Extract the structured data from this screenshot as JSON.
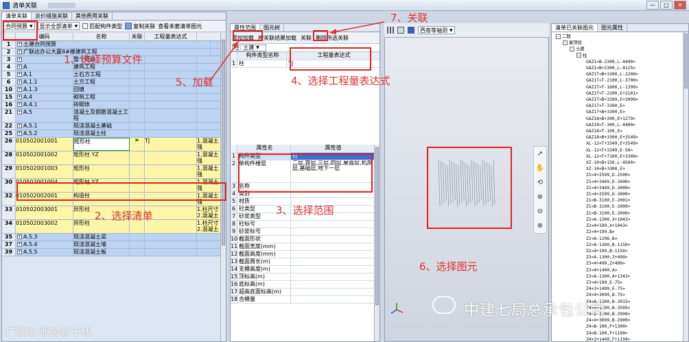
{
  "window": {
    "title": "清单关联",
    "min": "—",
    "max": "□",
    "close": "✕"
  },
  "left": {
    "tabs": [
      "清单关联",
      "总价措施关联",
      "其他费用关联"
    ],
    "toolbar": {
      "budget_select": "合同预算",
      "display_select": "显示全部清单",
      "checkbox_label": "匹配构件类型",
      "copy_label": "复制关联",
      "view_label": "查看未套清单图元"
    },
    "columns": [
      "",
      "编码",
      "名称",
      "关联",
      "工程量表达式"
    ],
    "rows": [
      {
        "n": "1",
        "code": "土建合同预算",
        "name": "",
        "rel": "",
        "exp": "",
        "x": "",
        "style": "blue",
        "tree": "pm",
        "span": true
      },
      {
        "n": "2",
        "code": "广联达办公大厦8#楼建筑工程",
        "name": "",
        "rel": "",
        "exp": "",
        "x": "",
        "style": "blue",
        "tree": "pm",
        "span": true
      },
      {
        "n": "3",
        "code": "",
        "name": "整个项目",
        "rel": "",
        "exp": "",
        "x": "",
        "style": "blue",
        "tree": "pm"
      },
      {
        "n": "4",
        "code": "A",
        "name": "建筑工程",
        "rel": "",
        "exp": "",
        "x": "",
        "style": "blue",
        "tree": "pm"
      },
      {
        "n": "5",
        "code": "A.1",
        "name": "土石方工程",
        "rel": "",
        "exp": "",
        "x": "",
        "style": "blue",
        "tree": "pm"
      },
      {
        "n": "6",
        "code": "A.1.1",
        "name": "土方工程",
        "rel": "",
        "exp": "",
        "x": "",
        "style": "blue",
        "tree": "pm"
      },
      {
        "n": "10",
        "code": "A.1.3",
        "name": "回填",
        "rel": "",
        "exp": "",
        "x": "",
        "style": "blue",
        "tree": "pm"
      },
      {
        "n": "15",
        "code": "A.4",
        "name": "砌筑工程",
        "rel": "",
        "exp": "",
        "x": "",
        "style": "blue",
        "tree": "pm"
      },
      {
        "n": "16",
        "code": "A.4.1",
        "name": "砖砌体",
        "rel": "",
        "exp": "",
        "x": "",
        "style": "blue",
        "tree": "pm"
      },
      {
        "n": "21",
        "code": "A.5",
        "name": "混凝土及钢筋混凝土工程",
        "rel": "",
        "exp": "",
        "x": "",
        "style": "blue",
        "tree": "pm",
        "tall": true
      },
      {
        "n": "22",
        "code": "A.5.1",
        "name": "现浇混凝土基础",
        "rel": "",
        "exp": "",
        "x": "",
        "style": "blue",
        "tree": "pm"
      },
      {
        "n": "25",
        "code": "A.5.2",
        "name": "现浇混凝土柱",
        "rel": "",
        "exp": "",
        "x": "",
        "style": "blue",
        "tree": "pm"
      },
      {
        "n": "26",
        "code": "010502001001",
        "name": "矩形柱",
        "rel": "⚑",
        "exp": "TJ",
        "x": "1.混凝土强",
        "style": "yel",
        "tall": true,
        "sel": true
      },
      {
        "n": "28",
        "code": "010502001002",
        "name": "矩形柱 YZ",
        "rel": "",
        "exp": "",
        "x": "1.混凝土强",
        "style": "yel",
        "tall": true
      },
      {
        "n": "29",
        "code": "010502001003",
        "name": "矩形柱",
        "rel": "",
        "exp": "",
        "x": "1.混凝土强",
        "style": "yel",
        "tall": true
      },
      {
        "n": "30",
        "code": "010502001004",
        "name": "矩形柱 YZ",
        "rel": "",
        "exp": "",
        "x": "1.混凝土强",
        "style": "yel",
        "tall": true
      },
      {
        "n": "32",
        "code": "010502002001",
        "name": "构造柱",
        "rel": "",
        "exp": "",
        "x": "1.混凝土强",
        "style": "yel",
        "tall": true
      },
      {
        "n": "33",
        "code": "010502003001",
        "name": "异形柱",
        "rel": "",
        "exp": "",
        "x": "1.柱尺寸 2.混凝土",
        "style": "yel",
        "tall": true
      },
      {
        "n": "34",
        "code": "010502003002",
        "name": "异形柱",
        "rel": "",
        "exp": "",
        "x": "1.柱尺寸 2.混凝土",
        "style": "yel",
        "tall": true
      },
      {
        "n": "35",
        "code": "A.5.3",
        "name": "现浇混凝土梁",
        "rel": "",
        "exp": "",
        "x": "",
        "style": "blue",
        "tree": "pm"
      },
      {
        "n": "37",
        "code": "A.5.4",
        "name": "现浇混凝土墙",
        "rel": "",
        "exp": "",
        "x": "",
        "style": "blue",
        "tree": "pm"
      },
      {
        "n": "39",
        "code": "A.5.5",
        "name": "现浇混凝土板",
        "rel": "",
        "exp": "",
        "x": "",
        "style": "blue",
        "tree": "pm"
      }
    ]
  },
  "middle": {
    "tabs": [
      "属性范围",
      "图元树"
    ],
    "buttons": {
      "load": "添加加载",
      "result": "按关联结果加载",
      "link": "关联",
      "delete": "删除所选关联"
    },
    "filter": "柱: 土建",
    "top_cols": [
      "构件类型名称",
      "工程量表达式"
    ],
    "top_rows": [
      {
        "n": "1",
        "k": "柱",
        "v": "TJ"
      }
    ],
    "prop_cols": [
      "属性名",
      "属性值"
    ],
    "props": [
      {
        "n": "1",
        "k": "构件类型",
        "v": "柱"
      },
      {
        "n": "2",
        "k": "单构件楼层",
        "v": "二层,首层,三层,四层,屋面层,机房层,基础层,地下一层"
      },
      {
        "n": "",
        "k": "",
        "v": ""
      },
      {
        "n": "",
        "k": "",
        "v": ""
      },
      {
        "n": "3",
        "k": "名称",
        "v": ""
      },
      {
        "n": "4",
        "k": "类别",
        "v": ""
      },
      {
        "n": "5",
        "k": "材质",
        "v": ""
      },
      {
        "n": "6",
        "k": "砼类型",
        "v": ""
      },
      {
        "n": "7",
        "k": "砂浆类型",
        "v": ""
      },
      {
        "n": "8",
        "k": "砼标号",
        "v": ""
      },
      {
        "n": "9",
        "k": "砂浆标号",
        "v": ""
      },
      {
        "n": "10",
        "k": "截面形状",
        "v": ""
      },
      {
        "n": "11",
        "k": "截面宽度(mm)",
        "v": ""
      },
      {
        "n": "12",
        "k": "截面高度(mm)",
        "v": ""
      },
      {
        "n": "13",
        "k": "截面周长(m)",
        "v": ""
      },
      {
        "n": "14",
        "k": "支模高度(m)",
        "v": ""
      },
      {
        "n": "15",
        "k": "顶标高(m)",
        "v": ""
      },
      {
        "n": "16",
        "k": "底标高(m)",
        "v": ""
      },
      {
        "n": "17",
        "k": "超高底面标高(m)",
        "v": ""
      },
      {
        "n": "18",
        "k": "含模量",
        "v": ""
      }
    ]
  },
  "viewport": {
    "view_select": "西南等轴测"
  },
  "tree": {
    "tabs": [
      "清单已关联图元",
      "图元属性"
    ],
    "root": "二期",
    "l1": "屋顶层",
    "l2": "土建",
    "l3": "柱",
    "items": [
      "GAZ1<B-2300,L-4400>",
      "GAZ1<B+2300,L-4125>",
      "GAZ1T<B+3300,L-2200>",
      "GAZ1T<T-2100,L-3700>",
      "GAZ1T<T-1600,L-1399>",
      "GAZ1T<T-2200,E+2101>",
      "GAZ1T<B+3399,E+2099>",
      "GAZ17<T-3300,E>",
      "GAZ17<B+3300,E>",
      "GAZ18<B+200,E+1279>",
      "GAZ19<T-300,L-4400>",
      "GAZ18<T-100,E>",
      "GAZ18<B+3300,E+3549>",
      "XL-12<T+3349,E+3549>",
      "XL-12<T+3349,E-50>",
      "XL-12<T+7100,E+3300>",
      "XZ-10<B+150,L-4500>",
      "XZ-10<B+3300,E>",
      "Z1<4+2599,D-2500>",
      "Z1<4+3449,D-2600>",
      "Z1<4+3449,D-3000>",
      "Z1<4+2599,D-3000>",
      "Z1<B-3100,E-2001>",
      "Z1<B-3100,E-2000>",
      "Z1<B-3100,E-2000>",
      "Z2<A-1300,X+1043>",
      "Z2<4+199,X+1043>",
      "Z2<4+199,B>",
      "Z2<A-1296,B>",
      "Z2<A-1300,B-1150>",
      "Z2<4+199,B-1150>",
      "Z3<A-1300,Z+499>",
      "Z3<4+499,Z+499>",
      "Z3<4+1400,A>",
      "Z3<A-1300,A+1343>",
      "Z3<4+199,E-75>",
      "Z4<3+1499,E-75>",
      "Z4<4+3099,B-75>",
      "Z4<A-1300,B-2015>",
      "Z4<4+1300,B-3505>",
      "Z4<B-1300,B-2900>",
      "Z4<4+3099,B-2900>",
      "Z4<B-100,F+1300>",
      "Z4<B-100,F+1199>",
      "Z4<3+1449,F+1199>"
    ]
  },
  "annotations": {
    "a1": "1、选择预算文件",
    "a2": "2、选择清单",
    "a3": "3、选择范围",
    "a4": "4、选择工程量表达式",
    "a5": "5、加载",
    "a6": "6、选择图元",
    "a7": "7、关联"
  },
  "watermarks": {
    "right": "中建七局总承包公司",
    "left": "广联达·服务新干线"
  },
  "colors": {
    "annotation": "#e03030",
    "header_blue": "#bcd3f2",
    "row_yellow": "#fdf6a6"
  }
}
